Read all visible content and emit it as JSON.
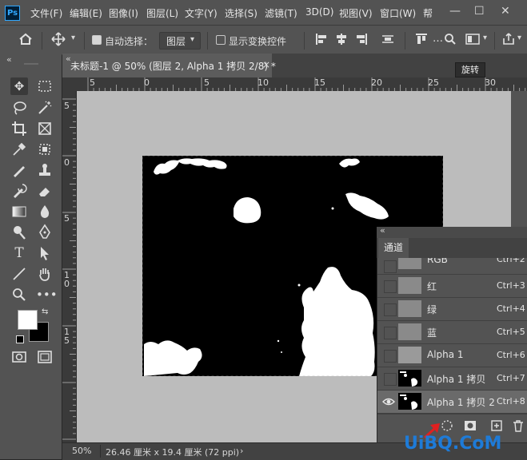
{
  "menubar": {
    "logo": "Ps",
    "items": [
      "文件(F)",
      "编辑(E)",
      "图像(I)",
      "图层(L)",
      "文字(Y)",
      "选择(S)",
      "滤镜(T)",
      "3D(D)",
      "视图(V)",
      "窗口(W)",
      "帮"
    ],
    "window_controls": [
      "—",
      "☐",
      "✕"
    ]
  },
  "options": {
    "auto_select_label": "自动选择：",
    "auto_select_checked": true,
    "auto_select_target": "图层",
    "show_transform_label": "显示变换控件",
    "show_transform_checked": false
  },
  "document": {
    "tab_title": "未标题-1 @ 50% (图层 2, Alpha 1 拷贝 2/8) *",
    "tab_close": "×",
    "tooltip": "旋转"
  },
  "rulers": {
    "h_ticks": [
      "5",
      "0",
      "5",
      "10",
      "15",
      "20",
      "25",
      "30"
    ],
    "v_ticks": [
      "5",
      "0",
      "5",
      "1",
      "0",
      "1",
      "5"
    ]
  },
  "status": {
    "zoom": "50%",
    "doc_size": "26.46 厘米 x 19.4 厘米 (72 ppi)",
    "arrow": "›"
  },
  "channels_panel": {
    "tab": "通道",
    "rows": [
      {
        "name": "RGB",
        "shortcut": "Ctrl+2"
      },
      {
        "name": "红",
        "shortcut": "Ctrl+3"
      },
      {
        "name": "绿",
        "shortcut": "Ctrl+4"
      },
      {
        "name": "蓝",
        "shortcut": "Ctrl+5"
      },
      {
        "name": "Alpha 1",
        "shortcut": "Ctrl+6"
      },
      {
        "name": "Alpha 1 拷贝",
        "shortcut": "Ctrl+7"
      },
      {
        "name": "Alpha 1 拷贝 2",
        "shortcut": "Ctrl+8"
      }
    ],
    "selected_row": "Alpha 1 拷贝 2",
    "footer_icons": [
      "load-selection-icon",
      "save-selection-icon",
      "new-channel-icon",
      "trash-icon"
    ]
  },
  "watermark": "UiBQ.CoM",
  "colors": {
    "foreground": "#ffffff",
    "background": "#000000",
    "ps_blue": "#31a8ff"
  }
}
